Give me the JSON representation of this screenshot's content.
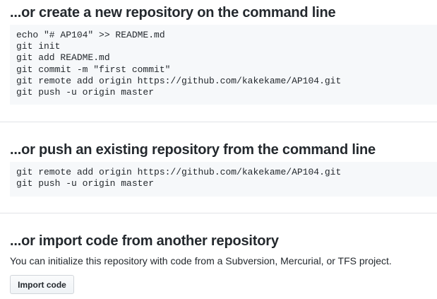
{
  "create_section": {
    "heading": "...or create a new repository on the command line",
    "code_lines": [
      "echo \"# AP104\" >> README.md",
      "git init",
      "git add README.md",
      "git commit -m \"first commit\"",
      "git remote add origin https://github.com/kakekame/AP104.git",
      "git push -u origin master"
    ]
  },
  "push_section": {
    "heading": "...or push an existing repository from the command line",
    "code_lines": [
      "git remote add origin https://github.com/kakekame/AP104.git",
      "git push -u origin master"
    ]
  },
  "import_section": {
    "heading": "...or import code from another repository",
    "description": "You can initialize this repository with code from a Subversion, Mercurial, or TFS project.",
    "button_label": "Import code"
  }
}
